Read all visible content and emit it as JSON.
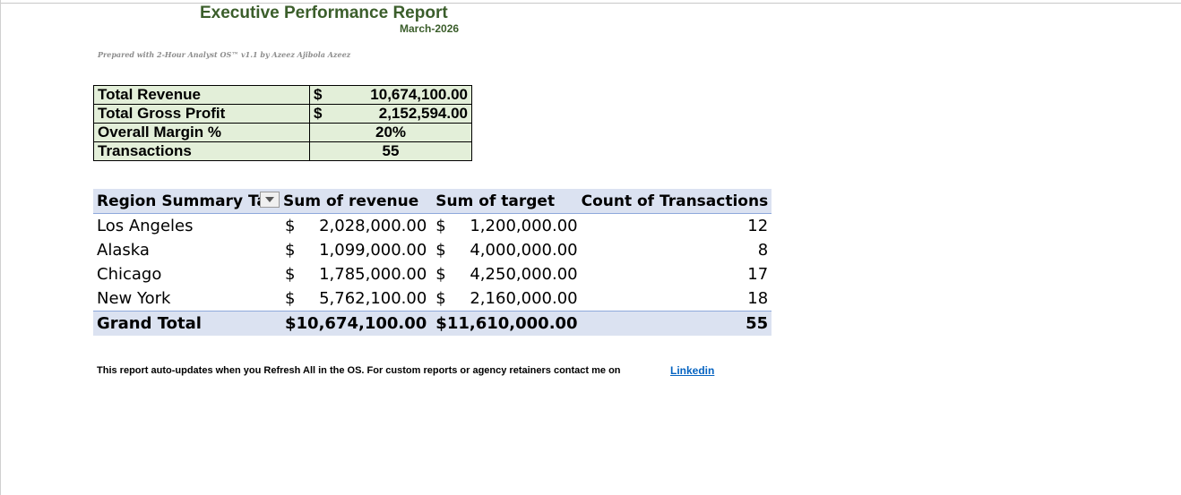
{
  "report": {
    "title": "Executive Performance Report",
    "period": "March-2026",
    "prepared_by": "Prepared with 2-Hour Analyst OS™ v1.1 by Azeez Ajibola Azeez"
  },
  "kpis": [
    {
      "label": "Total Revenue",
      "currency": "$",
      "value": "10,674,100.00"
    },
    {
      "label": "Total Gross Profit",
      "currency": "$",
      "value": "2,152,594.00"
    },
    {
      "label": "Overall Margin %",
      "currency": "",
      "value": "20%"
    },
    {
      "label": "Transactions",
      "currency": "",
      "value": "55"
    }
  ],
  "pivot": {
    "headers": [
      "Region Summary Tab",
      "Sum of  revenue",
      "Sum of  target",
      "Count of  Transactions"
    ],
    "rows": [
      {
        "region": "Los Angeles",
        "revenue": "2,028,000.00",
        "target": "1,200,000.00",
        "count": "12"
      },
      {
        "region": "Alaska",
        "revenue": "1,099,000.00",
        "target": "4,000,000.00",
        "count": "8"
      },
      {
        "region": "Chicago",
        "revenue": "1,785,000.00",
        "target": "4,250,000.00",
        "count": "17"
      },
      {
        "region": "New York",
        "revenue": "5,762,100.00",
        "target": "2,160,000.00",
        "count": "18"
      }
    ],
    "total": {
      "label": "Grand Total",
      "revenue": "10,674,100.00",
      "target": "11,610,000.00",
      "count": "55"
    },
    "currency": "$"
  },
  "footer": {
    "text": "This report auto-updates when you Refresh All in the OS. For custom reports or agency retainers contact me on",
    "link_label": "Linkedin"
  },
  "colors": {
    "title_green": "#3b5e2b",
    "kpi_fill": "#e3efd9",
    "pivot_band": "#dbe2f1",
    "link": "#0563c1"
  },
  "icons": {
    "filter": "chevron-down-icon"
  }
}
